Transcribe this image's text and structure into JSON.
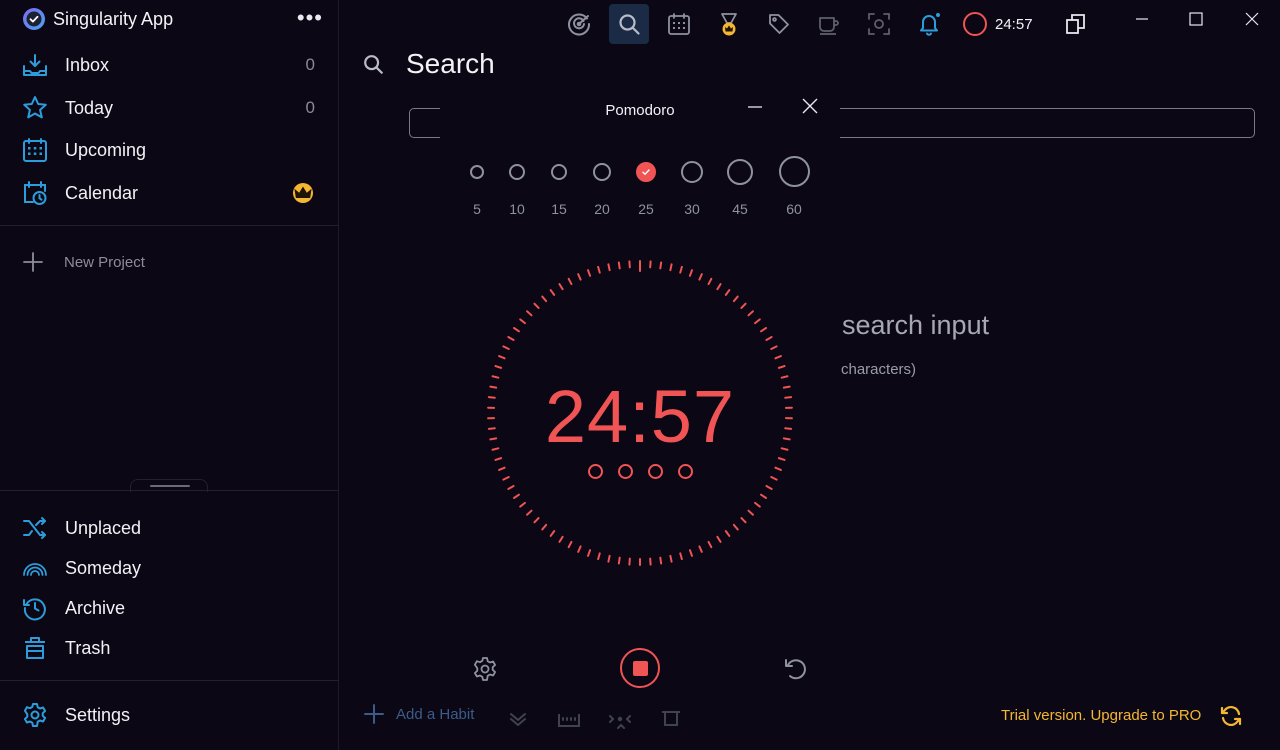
{
  "app": {
    "title": "Singularity App",
    "more": "•••"
  },
  "sidebar": {
    "items": [
      {
        "label": "Inbox",
        "count": "0",
        "icon": "inbox-icon"
      },
      {
        "label": "Today",
        "count": "0",
        "icon": "star-icon"
      },
      {
        "label": "Upcoming",
        "icon": "calendar-grid-icon"
      },
      {
        "label": "Calendar",
        "icon": "calendar-clock-icon",
        "badge": "crown-icon"
      }
    ],
    "new_project": "New Project",
    "bottom_items": [
      {
        "label": "Unplaced",
        "icon": "shuffle-icon"
      },
      {
        "label": "Someday",
        "icon": "rainbow-icon"
      },
      {
        "label": "Archive",
        "icon": "history-icon"
      },
      {
        "label": "Trash",
        "icon": "trash-icon"
      }
    ],
    "settings": "Settings"
  },
  "toolbar": {
    "icons": [
      "focus-target-icon",
      "search-icon",
      "calendar-icon",
      "medal-icon",
      "tag-icon",
      "coffee-icon",
      "scan-icon",
      "bell-icon"
    ],
    "timer": "24:57"
  },
  "search": {
    "title": "Search",
    "input_value": "",
    "empty_title": "search input",
    "empty_subtitle": "characters)"
  },
  "pomodoro": {
    "title": "Pomodoro",
    "durations": [
      "5",
      "10",
      "15",
      "20",
      "25",
      "30",
      "45",
      "60"
    ],
    "selected_duration": "25",
    "time": "24:57",
    "sessions": 4
  },
  "bottom": {
    "add_habit": "Add a Habit",
    "trial": "Trial version. Upgrade to PRO"
  },
  "colors": {
    "accent": "#2d9cdb",
    "timer": "#f05454",
    "pro": "#f5b731",
    "background": "#0b0714"
  }
}
